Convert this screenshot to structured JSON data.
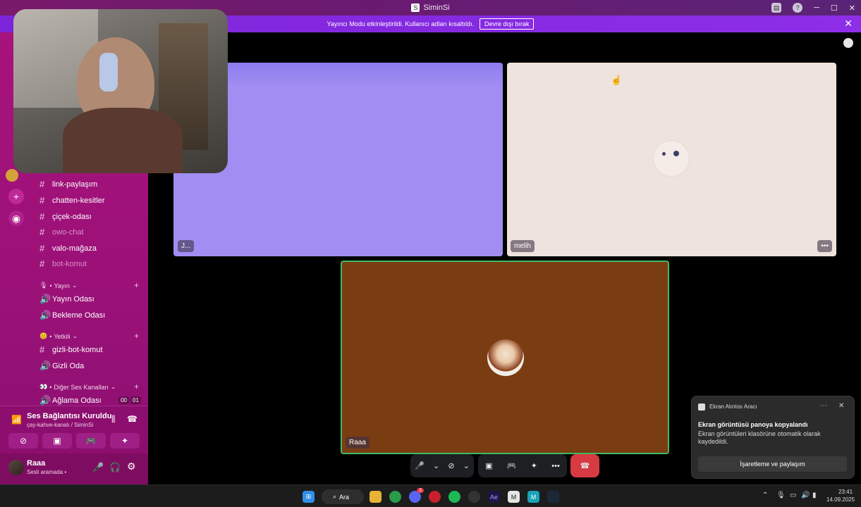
{
  "window": {
    "title": "SiminSi"
  },
  "banner": {
    "text": "Yayıncı Modu etkinleştirildi. Kullanıcı adları kısaltıldı.",
    "button": "Devre dışı bırak",
    "close": "✕"
  },
  "channels": {
    "text": [
      {
        "name": "link-paylaşım",
        "muted": false
      },
      {
        "name": "chatten-kesitler",
        "muted": false
      },
      {
        "name": "çiçek-odası",
        "muted": false
      },
      {
        "name": "owo-chat",
        "muted": true
      },
      {
        "name": "valo-mağaza",
        "muted": false
      },
      {
        "name": "bot-komut",
        "muted": true
      }
    ],
    "categories": {
      "yayin": {
        "label": "Yayın",
        "items": [
          "Yayın Odası",
          "Bekleme Odası"
        ]
      },
      "yetkili": {
        "label": "Yetkili",
        "items": [
          "gizli-bot-komut",
          "Gizli Oda"
        ]
      },
      "diger": {
        "label": "Diğer Ses Kanalları",
        "items": [
          "Ağlama Odası"
        ],
        "badge1": "00",
        "badge2": "01"
      }
    }
  },
  "voice": {
    "status": "Ses Bağlantısı Kuruldu",
    "channel": "çay-kahve-kanalı / SiminSi"
  },
  "user": {
    "name": "Raaa",
    "status": "Sesli aramada •"
  },
  "tiles": {
    "top_left_label": "J...",
    "top_right_label": "melih",
    "bottom_label": "Raaa",
    "colors": {
      "top_left": "#a08ef2",
      "top_right": "#efe3dd",
      "bottom": "#7a3d12"
    }
  },
  "toast": {
    "app": "Ekran Alıntısı Aracı",
    "title": "Ekran görüntüsü panoya kopyalandı",
    "body": "Ekran görüntüleri klasörüne otomatik olarak kaydedildi.",
    "button": "İşaretleme ve paylaşım"
  },
  "taskbar": {
    "search": "Ara",
    "time": "23:41",
    "date": "14.09.2025",
    "discord_badge": "3"
  }
}
